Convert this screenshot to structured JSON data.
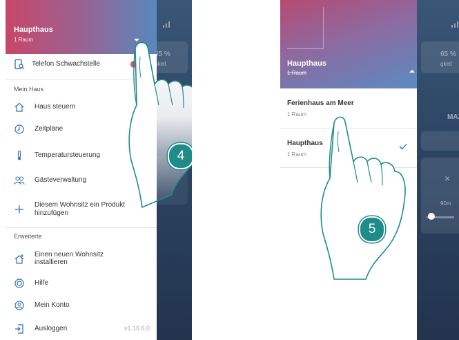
{
  "left_screen": {
    "header": {
      "title": "Haupthaus",
      "subtitle": "1 Raum"
    },
    "background_texts": {
      "humidity": "65 %",
      "humidity_sub": "gkeit"
    },
    "top_item": {
      "label": "Telefon Schwachstelle",
      "icon": "phone-search-icon"
    },
    "section_mein_haus": "Mein Haus",
    "menu_items": [
      {
        "label": "Haus steuern",
        "icon": "home-icon"
      },
      {
        "label": "Zeitpläne",
        "icon": "clock-icon"
      },
      {
        "label": "Temperatursteuerung",
        "icon": "thermometer-icon"
      },
      {
        "label": "Gästeverwaltung",
        "icon": "guests-icon"
      },
      {
        "label": "Diesem Wohnsitz ein Produkt",
        "label2": "hinzufügen",
        "icon": "plus-icon"
      }
    ],
    "section_erweiterte": "Erweiterte",
    "advanced_items": [
      {
        "label": "Einen neuen Wohnsitz",
        "label2": "installieren",
        "icon": "home-add-icon"
      },
      {
        "label": "Hilfe",
        "icon": "help-icon"
      },
      {
        "label": "Mein Konto",
        "icon": "account-icon"
      },
      {
        "label": "Ausloggen",
        "icon": "logout-icon"
      }
    ],
    "version": "v1.16.6.0",
    "step": "4"
  },
  "right_screen": {
    "header": {
      "title": "Haupthaus",
      "subtitle": "1 Raum"
    },
    "background_texts": {
      "humidity": "65 %",
      "humidity_sub": "gkeit",
      "max": "MAX",
      "time": "90m"
    },
    "options": [
      {
        "title": "Ferienhaus am Meer",
        "subtitle": "1 Raum",
        "selected": false
      },
      {
        "title": "Haupthaus",
        "subtitle": "1 Raum",
        "selected": true
      }
    ],
    "step": "5"
  },
  "colors": {
    "accent_teal": "#1f8c8a",
    "check_blue": "#3a8fd0",
    "header_gradient_start": "#c7476a",
    "header_gradient_end": "#5888bd",
    "app_background": "#2c4463"
  }
}
